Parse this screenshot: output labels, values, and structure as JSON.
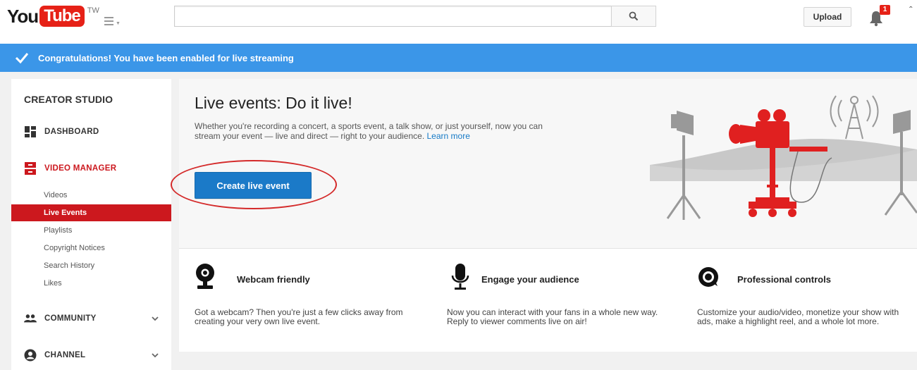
{
  "header": {
    "logo_you": "You",
    "logo_tube": "Tube",
    "logo_country": "TW",
    "search_placeholder": "",
    "upload_label": "Upload",
    "notification_count": "1"
  },
  "notification": {
    "text": "Congratulations! You have been enabled for live streaming",
    "color": "#3b96e8"
  },
  "sidebar": {
    "title": "CREATOR STUDIO",
    "dashboard_label": "DASHBOARD",
    "video_manager_label": "VIDEO MANAGER",
    "sub_items": [
      "Videos",
      "Live Events",
      "Playlists",
      "Copyright Notices",
      "Search History",
      "Likes"
    ],
    "active_sub_item": "Live Events",
    "community_label": "COMMUNITY",
    "channel_label": "CHANNEL",
    "accent_color": "#cc181e"
  },
  "hero": {
    "title": "Live events: Do it live!",
    "description": "Whether you're recording a concert, a sports event, a talk show, or just yourself, now you can stream your event — live and direct — right to your audience.",
    "learn_more": "Learn more",
    "create_button": "Create live event",
    "button_color": "#1b7ac8"
  },
  "features": [
    {
      "icon": "webcam-icon",
      "title": "Webcam friendly",
      "description": "Got a webcam? Then you're just a few clicks away from creating your very own live event."
    },
    {
      "icon": "microphone-icon",
      "title": "Engage your audience",
      "description": "Now you can interact with your fans in a whole new way. Reply to viewer comments live on air!"
    },
    {
      "icon": "controls-icon",
      "title": "Professional controls",
      "description": "Customize your audio/video, monetize your show with ads, make a highlight reel, and a whole lot more."
    }
  ]
}
